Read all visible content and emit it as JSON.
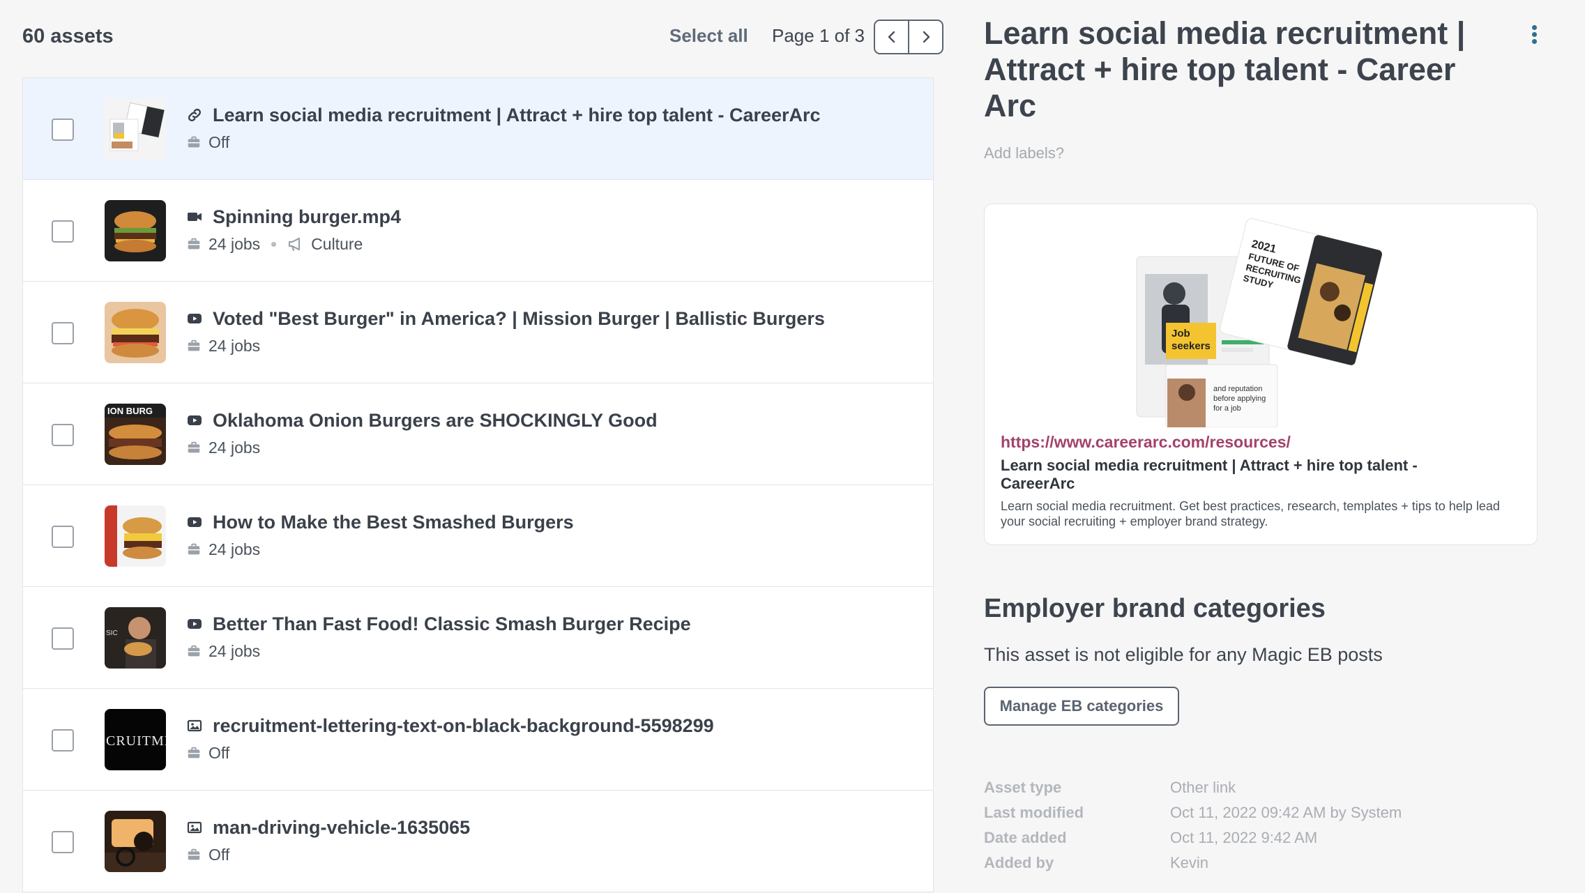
{
  "toolbar": {
    "asset_count": "60 assets",
    "select_all": "Select all",
    "page_label": "Page 1 of 3"
  },
  "icons": {
    "prev": "chevron-left-icon",
    "next": "chevron-right-icon",
    "link": "link-icon",
    "video": "video-camera-icon",
    "youtube": "play-button-icon",
    "image": "image-icon",
    "jobs": "briefcase-icon",
    "culture": "megaphone-icon",
    "more": "kebab-menu-icon"
  },
  "assets": [
    {
      "title": "Learn social media recruitment | Attract + hire top talent - CareerArc",
      "type": "link",
      "meta": "Off",
      "tag": "",
      "selected": true
    },
    {
      "title": "Spinning burger.mp4",
      "type": "video",
      "meta": "24 jobs",
      "tag": "Culture",
      "selected": false
    },
    {
      "title": "Voted \"Best Burger\" in America? | Mission Burger | Ballistic Burgers",
      "type": "youtube",
      "meta": "24 jobs",
      "tag": "",
      "selected": false
    },
    {
      "title": "Oklahoma Onion Burgers are SHOCKINGLY Good",
      "type": "youtube",
      "meta": "24 jobs",
      "tag": "",
      "selected": false
    },
    {
      "title": "How to Make the Best Smashed Burgers",
      "type": "youtube",
      "meta": "24 jobs",
      "tag": "",
      "selected": false
    },
    {
      "title": "Better Than Fast Food! Classic Smash Burger Recipe",
      "type": "youtube",
      "meta": "24 jobs",
      "tag": "",
      "selected": false
    },
    {
      "title": "recruitment-lettering-text-on-black-background-5598299",
      "type": "image",
      "meta": "Off",
      "tag": "",
      "selected": false
    },
    {
      "title": "man-driving-vehicle-1635065",
      "type": "image",
      "meta": "Off",
      "tag": "",
      "selected": false
    }
  ],
  "detail": {
    "title": "Learn social media recruitment | Attract + hire top talent - Career Arc",
    "add_labels": "Add labels?",
    "preview": {
      "url": "https://www.careerarc.com/resources/",
      "heading": "Learn social media recruitment | Attract + hire top talent - CareerArc",
      "description": "Learn social media recruitment. Get best practices, research, templates + tips to help lead your social recruiting + employer brand strategy.",
      "image_text": {
        "study_line1": "2021",
        "study_line2": "FUTURE OF",
        "study_line3": "RECRUITING",
        "study_line4": "STUDY",
        "job_seekers_1": "Job",
        "job_seekers_2": "seekers",
        "snippet_1": "and reputation",
        "snippet_2": "before applying",
        "snippet_3": "for a job"
      }
    },
    "eb": {
      "heading": "Employer brand categories",
      "text": "This asset is not eligible for any Magic EB posts",
      "button": "Manage EB categories"
    },
    "info": [
      {
        "key": "Asset type",
        "value": "Other link"
      },
      {
        "key": "Last modified",
        "value": "Oct 11, 2022 09:42 AM by System"
      },
      {
        "key": "Date added",
        "value": "Oct 11, 2022 9:42 AM"
      },
      {
        "key": "Added by",
        "value": "Kevin"
      }
    ]
  },
  "colors": {
    "selected_row": "#eef4fd",
    "url": "#a3426a",
    "accent_yellow": "#f4c430",
    "kebab": "#2f6f8f"
  }
}
